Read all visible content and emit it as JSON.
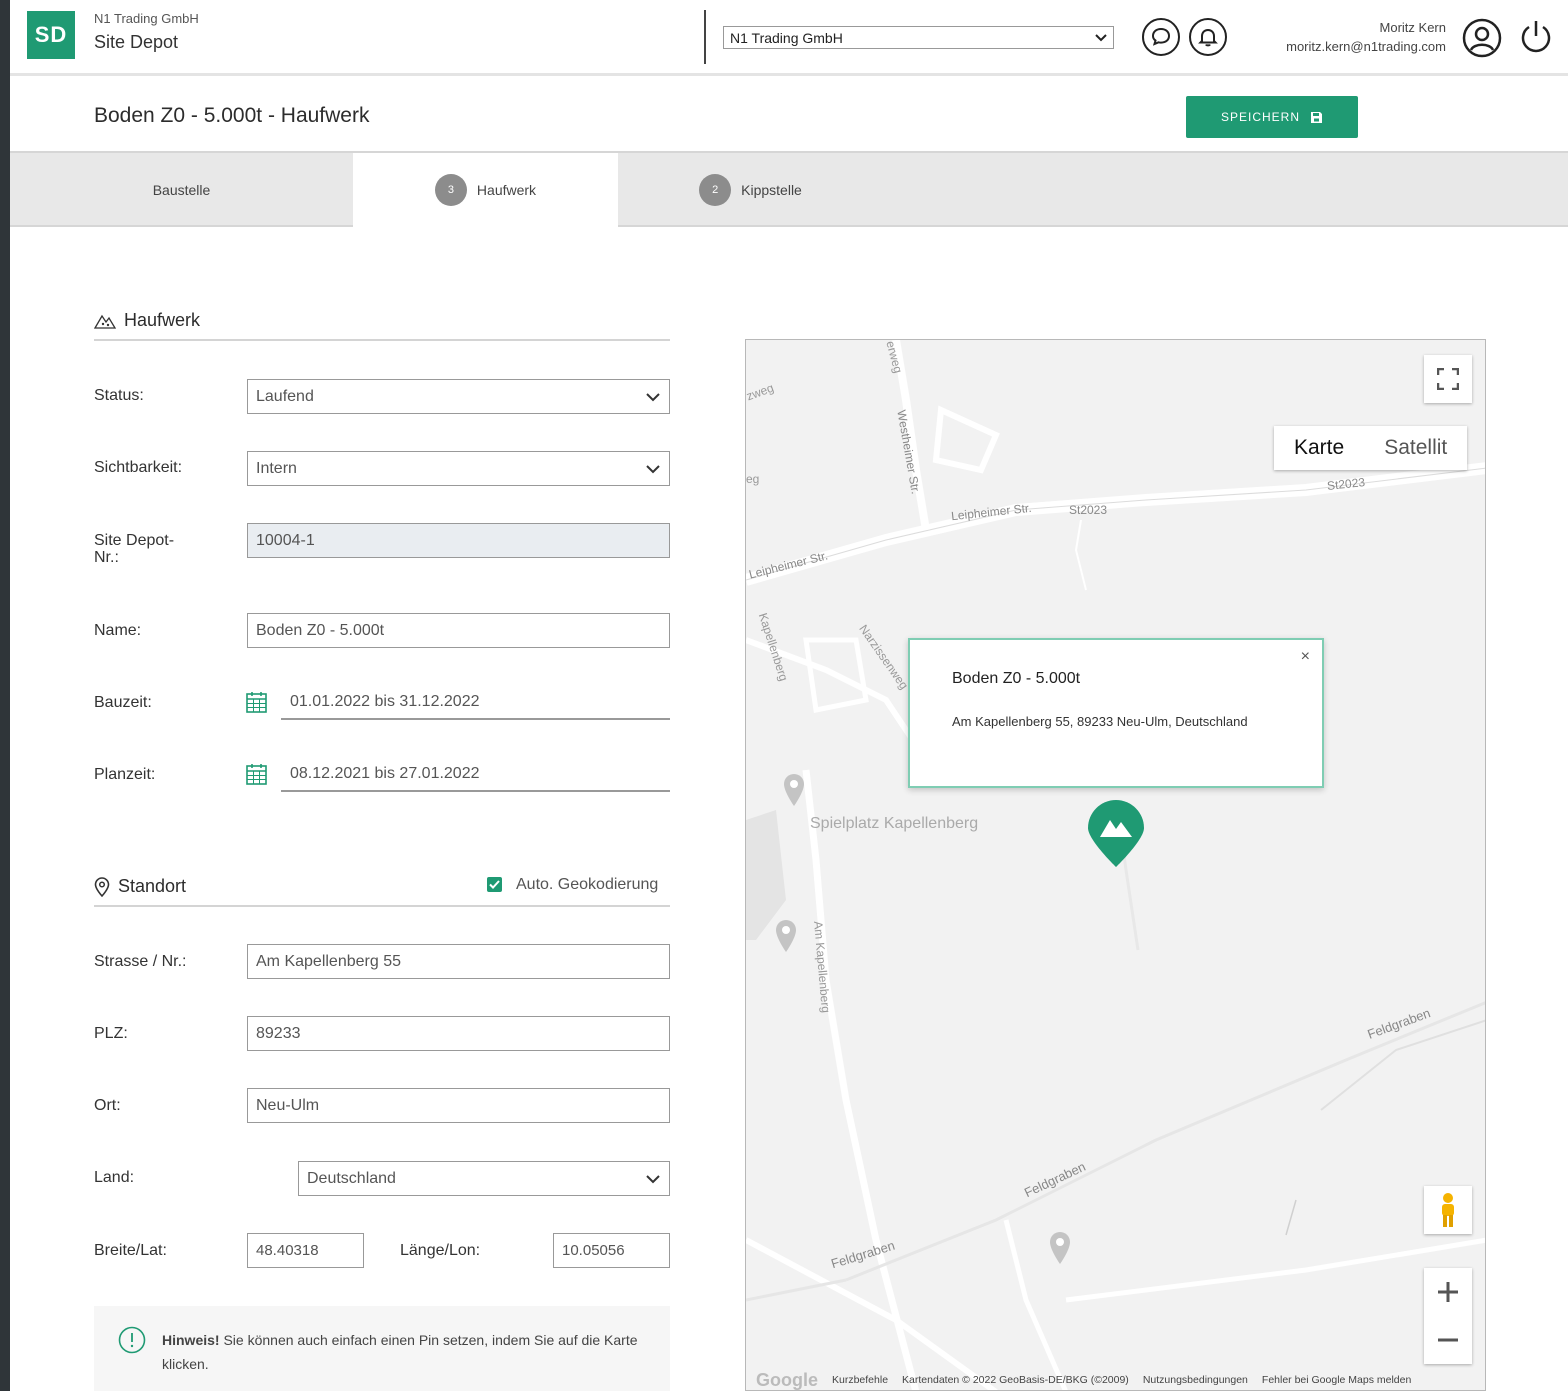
{
  "header": {
    "logo": "SD",
    "company_small": "N1 Trading GmbH",
    "app_name": "Site Depot",
    "company_select_value": "N1 Trading GmbH",
    "user_name": "Moritz Kern",
    "user_email": "moritz.kern@n1trading.com"
  },
  "title": {
    "text": "Boden Z0 - 5.000t - Haufwerk",
    "save_label": "SPEICHERN"
  },
  "tabs": [
    {
      "label": "Baustelle",
      "num": ""
    },
    {
      "label": "Haufwerk",
      "num": "3"
    },
    {
      "label": "Kippstelle",
      "num": "2"
    }
  ],
  "haufwerk": {
    "heading": "Haufwerk",
    "status_label": "Status:",
    "status_value": "Laufend",
    "visibility_label": "Sichtbarkeit:",
    "visibility_value": "Intern",
    "depot_nr_label_1": "Site Depot-",
    "depot_nr_label_2": "Nr.:",
    "depot_nr_value": "10004-1",
    "name_label": "Name:",
    "name_value": "Boden Z0 - 5.000t",
    "bauzeit_label": "Bauzeit:",
    "bauzeit_value": "01.01.2022 bis 31.12.2022",
    "planzeit_label": "Planzeit:",
    "planzeit_value": "08.12.2021 bis 27.01.2022"
  },
  "standort": {
    "heading": "Standort",
    "auto_geo_label": "Auto. Geokodierung",
    "auto_geo_checked": true,
    "street_label": "Strasse / Nr.:",
    "street_value": "Am Kapellenberg 55",
    "plz_label": "PLZ:",
    "plz_value": "89233",
    "ort_label": "Ort:",
    "ort_value": "Neu-Ulm",
    "land_label": "Land:",
    "land_value": "Deutschland",
    "lat_label": "Breite/Lat:",
    "lat_value": "48.40318",
    "lon_label": "Länge/Lon:",
    "lon_value": "10.05056"
  },
  "hint": {
    "bold": "Hinweis!",
    "text": " Sie können auch einfach einen Pin setzen, indem Sie auf die Karte klicken."
  },
  "map": {
    "type_karte": "Karte",
    "type_satellit": "Satellit",
    "popup_title": "Boden Z0 - 5.000t",
    "popup_address": "Am Kapellenberg 55, 89233 Neu-Ulm, Deutschland",
    "popup_close": "×",
    "labels": {
      "leipheimer_1": "Leipheimer Str.",
      "st2023_1": "St2023",
      "st2023_2": "St2023",
      "leipheimer_2": "Leipheimer Str.",
      "westheimer": "Westheimer Str.",
      "kapellenberg_top": "Kapellenberg",
      "narzissenweg": "Narzissenweg",
      "spielplatz": "Spielplatz Kapellenberg",
      "am_kapellenberg": "Am Kapellenberg",
      "feldgraben_1": "Feldgraben",
      "feldgraben_2": "Feldgraben",
      "feldgraben_3": "Feldgraben",
      "frag_weg": "weg",
      "frag_zweg": "zweg",
      "frag_eg": "eg",
      "frag_erweg": "erweg"
    },
    "footer": {
      "google": "Google",
      "shortcuts": "Kurzbefehle",
      "mapdata": "Kartendaten © 2022 GeoBasis-DE/BKG (©2009)",
      "terms": "Nutzungsbedingungen",
      "report": "Fehler bei Google Maps melden"
    }
  },
  "colors": {
    "brand": "#1f9a73",
    "tab_bg": "#e8e8e8",
    "dark_strip": "#2f3539"
  }
}
